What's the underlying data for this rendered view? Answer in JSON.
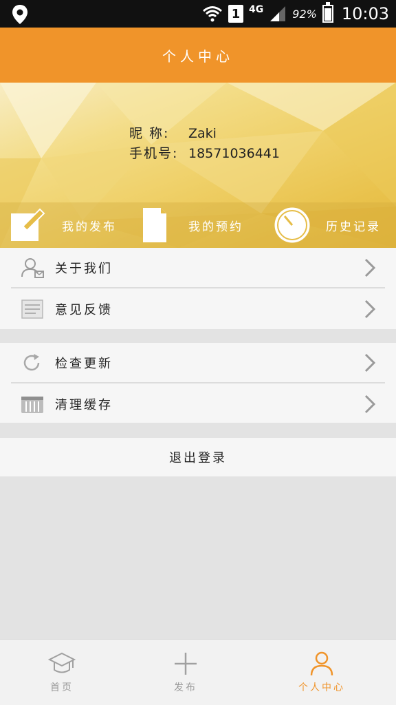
{
  "status_bar": {
    "network": "4G",
    "sim": "1",
    "battery": "92%",
    "time": "10:03"
  },
  "title": "个人中心",
  "profile": {
    "nickname_label": "昵  称:",
    "nickname": "Zaki",
    "phone_label": "手机号:",
    "phone": "18571036441"
  },
  "quick_actions": [
    {
      "label": "我的发布",
      "icon": "edit-icon"
    },
    {
      "label": "我的预约",
      "icon": "document-icon"
    },
    {
      "label": "历史记录",
      "icon": "clock-icon"
    }
  ],
  "menu": {
    "group1": [
      {
        "label": "关于我们",
        "icon": "user-card-icon"
      },
      {
        "label": "意见反馈",
        "icon": "feedback-doc-icon"
      }
    ],
    "group2": [
      {
        "label": "检查更新",
        "icon": "refresh-icon"
      },
      {
        "label": "清理缓存",
        "icon": "trash-icon"
      }
    ]
  },
  "logout_label": "退出登录",
  "tabs": [
    {
      "label": "首页",
      "icon": "graduation-cap-icon",
      "active": false
    },
    {
      "label": "发布",
      "icon": "plus-icon",
      "active": false
    },
    {
      "label": "个人中心",
      "icon": "person-icon",
      "active": true
    }
  ],
  "colors": {
    "accent": "#f0942a",
    "tab_inactive": "#9a9a9a"
  }
}
